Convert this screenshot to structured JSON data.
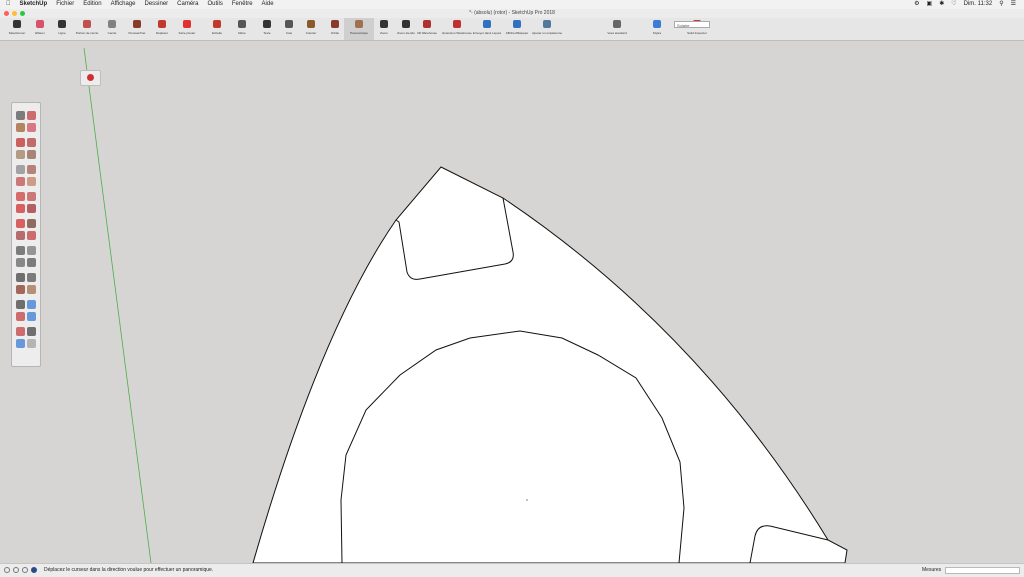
{
  "menubar": {
    "app_name": "SketchUp",
    "items": [
      "Fichier",
      "Édition",
      "Affichage",
      "Dessiner",
      "Caméra",
      "Outils",
      "Fenêtre",
      "Aide"
    ],
    "clock": "Dim. 11:32"
  },
  "window": {
    "title": "*- (absolu) (rotor) - SketchUp Pro 2018"
  },
  "toolbar": {
    "items": [
      {
        "label": "Sélectionner",
        "icon": "select-arrow-icon",
        "color": "#333333"
      },
      {
        "label": "Effacer",
        "icon": "eraser-icon",
        "color": "#d9506a"
      },
      {
        "label": "Ligne",
        "icon": "line-pencil-icon",
        "color": "#333333"
      },
      {
        "label": "Portion de cercle",
        "icon": "arc-icon",
        "color": "#c0504d"
      },
      {
        "label": "Cercle",
        "icon": "circle-icon",
        "color": "#808080"
      },
      {
        "label": "Pousser/tirer",
        "icon": "push-pull-icon",
        "color": "#8a3a2a"
      },
      {
        "label": "Déplacer",
        "icon": "move-icon",
        "color": "#c0392b"
      },
      {
        "label": "Faire pivoter",
        "icon": "rotate-icon",
        "color": "#e03030"
      },
      {
        "label": "Echelle",
        "icon": "scale-icon",
        "color": "#c0392b"
      },
      {
        "label": "Mètre",
        "icon": "tape-measure-icon",
        "color": "#555555"
      },
      {
        "label": "Texte",
        "icon": "text-icon",
        "color": "#333333"
      },
      {
        "label": "Cote",
        "icon": "dimension-icon",
        "color": "#555555"
      },
      {
        "label": "Colorier",
        "icon": "paint-bucket-icon",
        "color": "#8a5a2a"
      },
      {
        "label": "Orbite",
        "icon": "orbit-icon",
        "color": "#8a3a2a"
      },
      {
        "label": "Panoramique",
        "icon": "pan-hand-icon",
        "color": "#a07050"
      },
      {
        "label": "Zoom",
        "icon": "zoom-icon",
        "color": "#333333"
      },
      {
        "label": "Zoom étendu",
        "icon": "zoom-extents-icon",
        "color": "#333333"
      },
      {
        "label": "3D Warehouse",
        "icon": "warehouse-icon",
        "color": "#b03030"
      },
      {
        "label": "Extension Warehouse",
        "icon": "extension-icon",
        "color": "#c03030"
      },
      {
        "label": "Envoyer dans Layout",
        "icon": "layout-icon",
        "color": "#3070c0"
      },
      {
        "label": "Afficher/Masquer",
        "icon": "toggle-icon",
        "color": "#3070c0"
      },
      {
        "label": "Ajouter un emplacement",
        "icon": "location-icon",
        "color": "#557799"
      },
      {
        "label": "Vues standard",
        "icon": "standard-views-icon",
        "color": "#666666"
      },
      {
        "label": "Styles",
        "icon": "styles-icon",
        "color": "#3a7bd5"
      },
      {
        "label": "Solid Inspector",
        "icon": "solid-inspector-icon",
        "color": "#d03030"
      }
    ],
    "style_value": "Solaire"
  },
  "palette": {
    "tools": [
      "select-icon",
      "paint-icon",
      "eraser-icon",
      "tag-icon",
      "pencil-icon",
      "freehand-icon",
      "rectangle-icon",
      "rotated-rectangle-icon",
      "circle-icon",
      "polygon-icon",
      "arc-icon",
      "pie-icon",
      "two-point-arc-icon",
      "three-point-arc-icon",
      "move-icon",
      "push-pull-icon",
      "rotate-icon",
      "follow-me-icon",
      "scale-icon",
      "offset-icon",
      "tape-icon",
      "dimension-icon",
      "protractor-icon",
      "text-icon",
      "axes-icon",
      "3d-text-icon",
      "orbit-icon",
      "pan-icon",
      "zoom-icon",
      "zoom-window-icon",
      "zoom-extents-icon",
      "previous-view-icon",
      "position-camera-icon",
      "walk-icon",
      "look-around-icon",
      "section-plane-icon"
    ]
  },
  "status": {
    "message": "Déplacez le curseur dans la direction voulue pour effectuer un panoramique.",
    "measures_label": "Mesures",
    "measures_value": ""
  },
  "colors": {
    "canvas_bg": "#d6d5d3",
    "green_axis": "#4cae4c",
    "model_fill": "#ffffff",
    "model_edge": "#111111"
  }
}
